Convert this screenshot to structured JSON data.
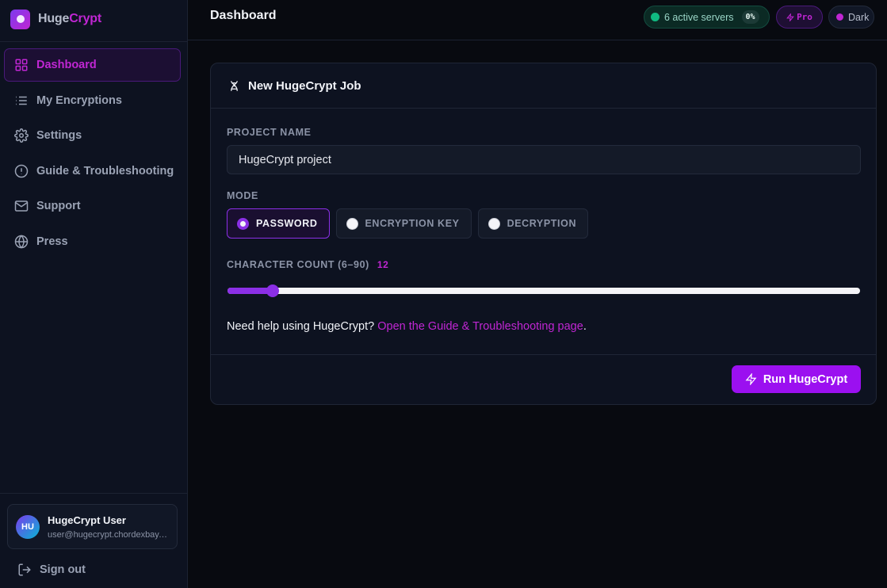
{
  "brand": {
    "name_main": "Huge",
    "name_accent": "Crypt"
  },
  "sidebar": {
    "items": [
      {
        "label": "Dashboard",
        "icon": "grid-icon",
        "active": true
      },
      {
        "label": "My Encryptions",
        "icon": "list-icon"
      },
      {
        "label": "Settings",
        "icon": "gear-icon"
      },
      {
        "label": "Guide & Troubleshooting",
        "icon": "info-icon"
      },
      {
        "label": "Support",
        "icon": "mail-icon"
      },
      {
        "label": "Press",
        "icon": "globe-icon"
      }
    ]
  },
  "user": {
    "initials": "HU",
    "name": "HugeCrypt User",
    "email": "user@hugecrypt.chordexbay.com"
  },
  "signout_label": "Sign out",
  "header": {
    "title": "Dashboard",
    "servers_label": "6 active servers",
    "servers_load": "0%",
    "pro_label": "Pro",
    "theme_label": "Dark"
  },
  "job": {
    "title": "New HugeCrypt Job",
    "project_label": "PROJECT NAME",
    "project_value": "HugeCrypt project",
    "mode_label": "MODE",
    "modes": [
      "PASSWORD",
      "ENCRYPTION KEY",
      "DECRYPTION"
    ],
    "selected_mode": "PASSWORD",
    "count_label": "CHARACTER COUNT (6–90)",
    "count_value": "12",
    "count_min": 6,
    "count_max": 90,
    "help_text": "Need help using HugeCrypt? ",
    "help_link": "Open the Guide & Troubleshooting page",
    "help_end": ".",
    "run_label": "Run HugeCrypt"
  },
  "colors": {
    "accent": "#c026d3",
    "primary": "#9b10f0",
    "success": "#10b981",
    "background": "#080a10"
  }
}
